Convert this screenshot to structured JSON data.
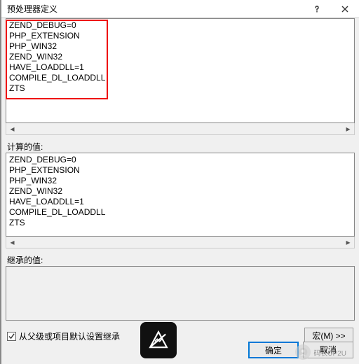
{
  "titlebar": {
    "title": "预处理器定义"
  },
  "editor": {
    "lines": [
      "ZEND_DEBUG=0",
      "PHP_EXTENSION",
      "PHP_WIN32",
      "ZEND_WIN32",
      "HAVE_LOADDLL=1",
      "COMPILE_DL_LOADDLL",
      "ZTS"
    ]
  },
  "computed": {
    "label": "计算的值:",
    "lines": [
      "ZEND_DEBUG=0",
      "PHP_EXTENSION",
      "PHP_WIN32",
      "ZEND_WIN32",
      "HAVE_LOADDLL=1",
      "COMPILE_DL_LOADDLL",
      "ZTS"
    ]
  },
  "inherited": {
    "label": "继承的值:"
  },
  "footer": {
    "inherit_checkbox": {
      "checked": true,
      "label": "从父级或项目默认设置继承"
    },
    "macro_button": "宏(M) >>"
  },
  "buttons": {
    "ok": "确定",
    "cancel": "取消"
  },
  "watermark": {
    "text": "码农UP2U"
  }
}
